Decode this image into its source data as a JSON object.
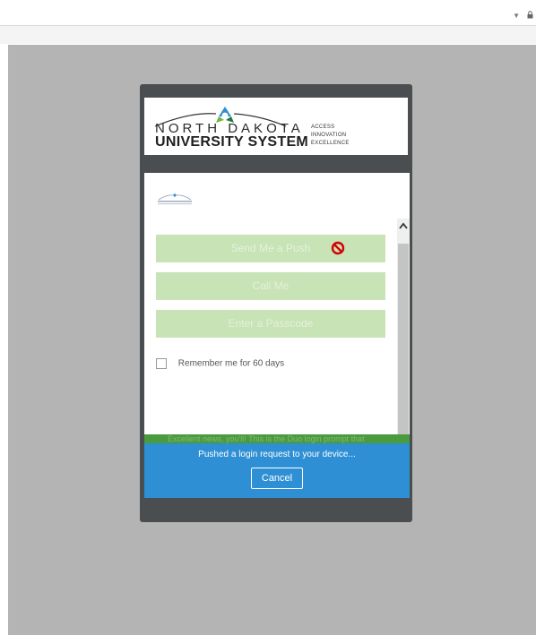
{
  "logo": {
    "line1": "NORTH DAKOTA",
    "line2": "UNIVERSITY SYSTEM",
    "tagline": [
      "ACCESS",
      "INNOVATION",
      "EXCELLENCE"
    ]
  },
  "methods": {
    "push": "Send Me a Push",
    "call": "Call Me",
    "passcode": "Enter a Passcode"
  },
  "remember": {
    "label": "Remember me for 60 days",
    "checked": false
  },
  "footer_strip": {
    "text": "Excellent news, you'll! This is the Duo login prompt that"
  },
  "notice": {
    "message": "Pushed a login request to your device...",
    "cancel": "Cancel"
  },
  "colors": {
    "accent_blue": "#2f8fd4",
    "button_green": "#c8e3b6",
    "strip_green": "#4a9a3e",
    "frame_dark": "#4b4e50",
    "backdrop_gray": "#b4b4b4"
  },
  "icons": {
    "dropdown": "chevron-down-icon",
    "lock": "lock-icon",
    "disabled": "no-entry-icon",
    "scroll": "chevron-up-icon"
  }
}
